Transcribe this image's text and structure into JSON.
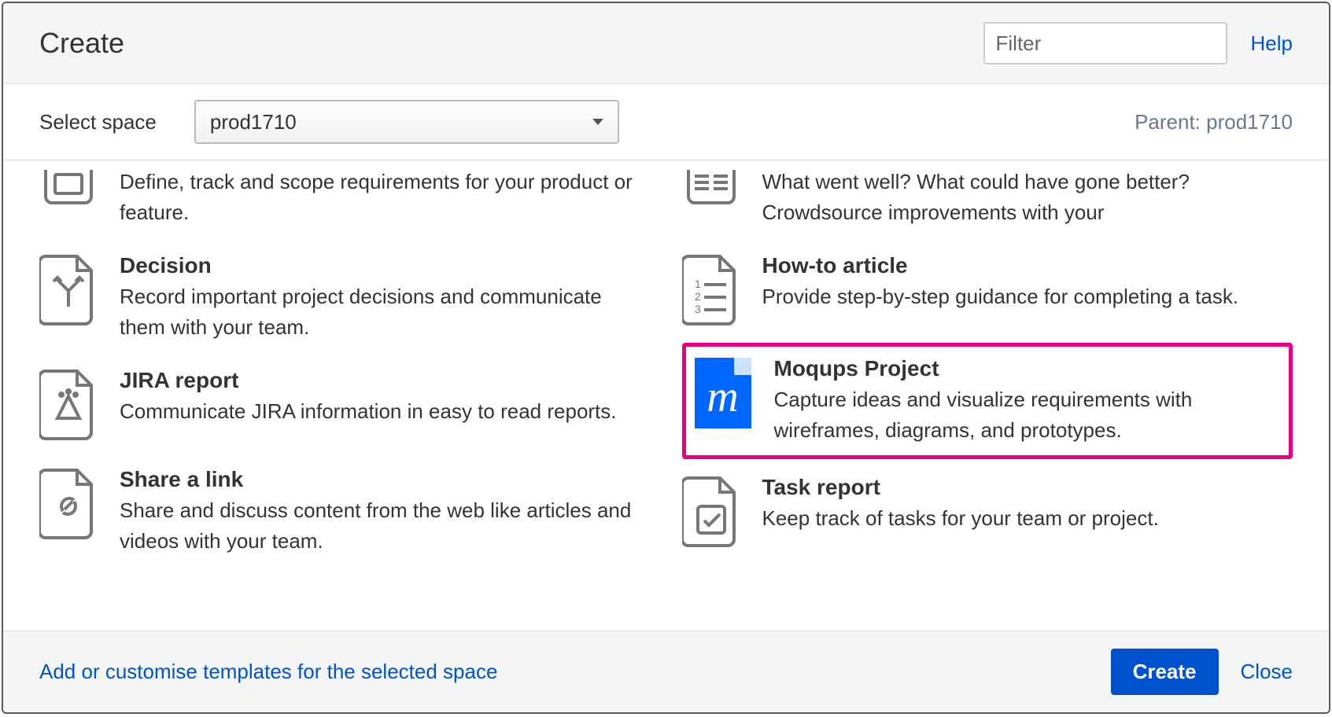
{
  "header": {
    "title": "Create",
    "filter_placeholder": "Filter",
    "help": "Help"
  },
  "space": {
    "label": "Select space",
    "selected": "prod1710",
    "parent_label": "Parent: prod1710"
  },
  "templates": {
    "left": [
      {
        "title": "",
        "desc": "Define, track and scope requirements for your product or feature."
      },
      {
        "title": "Decision",
        "desc": "Record important project decisions and communicate them with your team."
      },
      {
        "title": "JIRA report",
        "desc": "Communicate JIRA information in easy to read reports."
      },
      {
        "title": "Share a link",
        "desc": "Share and discuss content from the web like articles and videos with your team."
      }
    ],
    "right": [
      {
        "title": "",
        "desc": "What went well? What could have gone better? Crowdsource improvements with your"
      },
      {
        "title": "How-to article",
        "desc": "Provide step-by-step guidance for completing a task."
      },
      {
        "title": "Moqups Project",
        "desc": "Capture ideas and visualize requirements with wireframes, diagrams, and prototypes.",
        "highlighted": true
      },
      {
        "title": "Task report",
        "desc": "Keep track of tasks for your team or project."
      }
    ]
  },
  "footer": {
    "customise": "Add or customise templates for the selected space",
    "create": "Create",
    "close": "Close"
  }
}
